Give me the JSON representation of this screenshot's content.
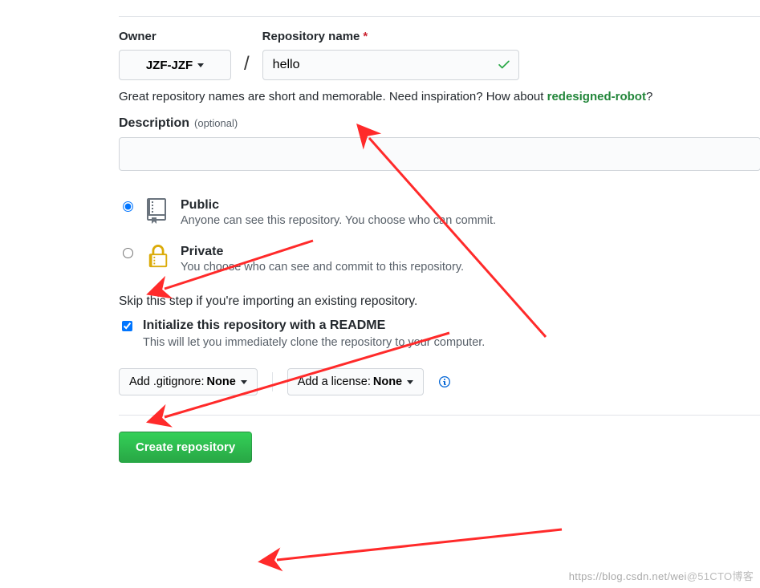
{
  "owner": {
    "label": "Owner",
    "selected": "JZF-JZF"
  },
  "repo": {
    "label": "Repository name",
    "value": "hello"
  },
  "hint": {
    "prefix": "Great repository names are short and memorable. Need inspiration? How about ",
    "suggestion": "redesigned-robot",
    "suffix": "?"
  },
  "description": {
    "label": "Description",
    "optional": "(optional)"
  },
  "visibility": {
    "public": {
      "title": "Public",
      "desc": "Anyone can see this repository. You choose who can commit."
    },
    "private": {
      "title": "Private",
      "desc": "You choose who can see and commit to this repository."
    }
  },
  "skip_text": "Skip this step if you're importing an existing repository.",
  "initialize": {
    "title": "Initialize this repository with a README",
    "desc": "This will let you immediately clone the repository to your computer."
  },
  "dropdowns": {
    "gitignore": {
      "prefix": "Add .gitignore:",
      "value": "None"
    },
    "license": {
      "prefix": "Add a license:",
      "value": "None"
    }
  },
  "create_label": "Create repository",
  "watermark": {
    "left": "https://blog.csdn.net/wei",
    "right": "@51CTO博客"
  }
}
